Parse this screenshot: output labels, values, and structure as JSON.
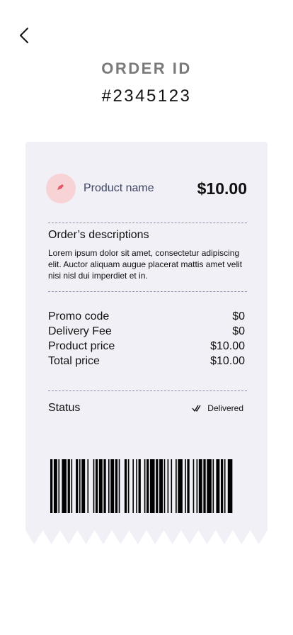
{
  "header": {
    "back_icon": "chevron-left-icon",
    "order_label": "ORDER ID",
    "order_number": "#2345123"
  },
  "product": {
    "icon": "tag-icon",
    "name": "Product name",
    "price": "$10.00",
    "avatar_color": "#f8d3d5"
  },
  "description": {
    "title": "Order’s descriptions",
    "body": "Lorem ipsum dolor sit amet, consectetur adipiscing elit. Auctor aliquam augue placerat mattis amet velit nisi nisl dui imperdiet et in."
  },
  "fees": [
    {
      "label": "Promo code",
      "value": "$0"
    },
    {
      "label": "Delivery Fee",
      "value": "$0"
    },
    {
      "label": "Product price",
      "value": "$10.00"
    },
    {
      "label": "Total price",
      "value": "$10.00"
    }
  ],
  "status": {
    "label": "Status",
    "value": "Delivered",
    "icon": "double-check-icon"
  },
  "colors": {
    "receipt_background": "#f0f0f6",
    "accent": "#e05a66"
  }
}
